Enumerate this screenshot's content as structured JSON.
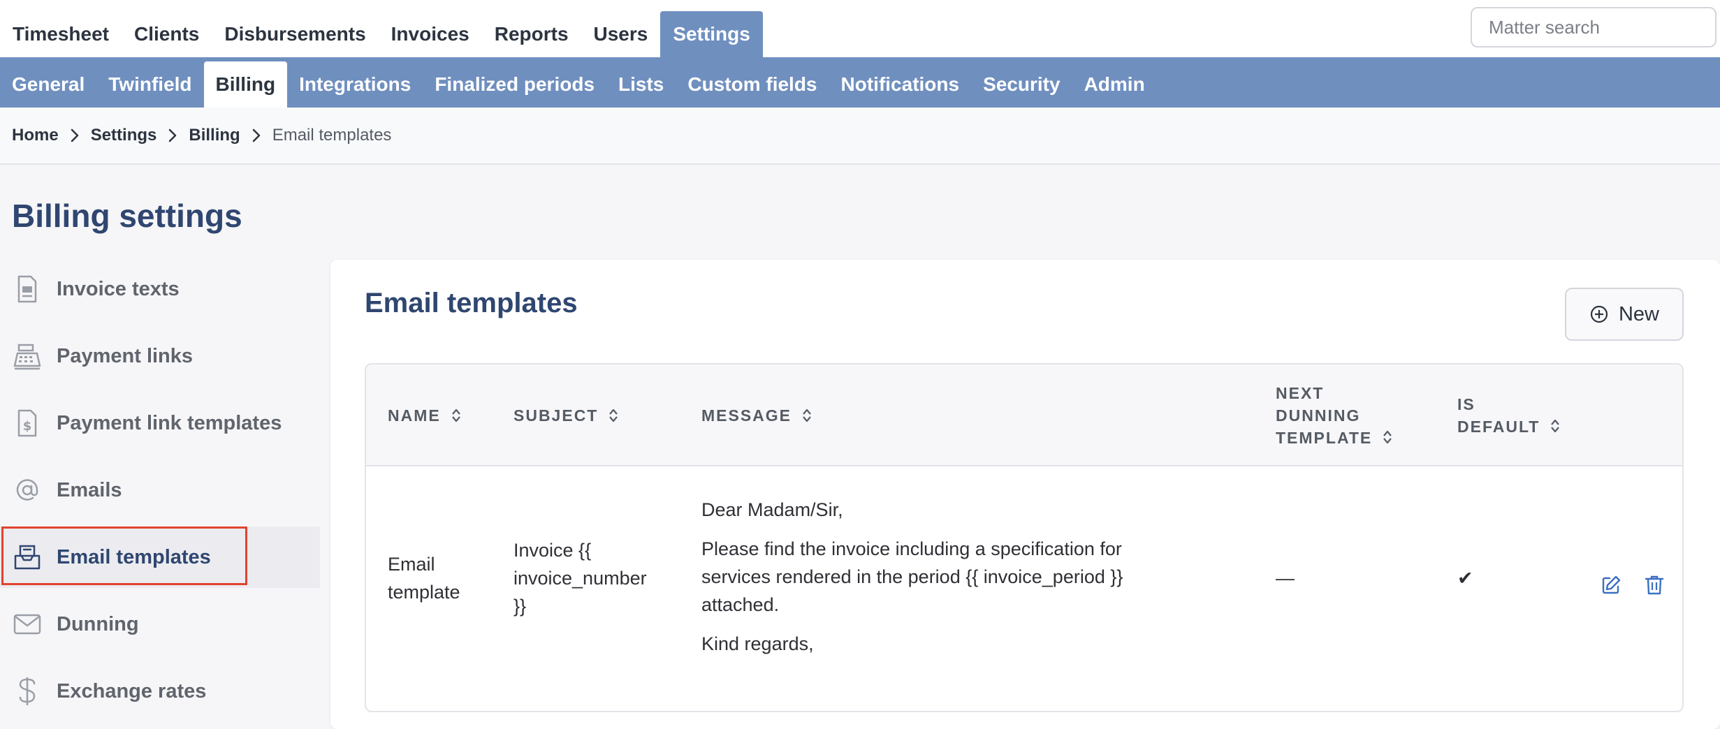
{
  "top_nav": {
    "tabs": [
      "Timesheet",
      "Clients",
      "Disbursements",
      "Invoices",
      "Reports",
      "Users",
      "Settings"
    ],
    "active": "Settings"
  },
  "search": {
    "placeholder": "Matter search",
    "value": ""
  },
  "sub_nav": {
    "tabs": [
      "General",
      "Twinfield",
      "Billing",
      "Integrations",
      "Finalized periods",
      "Lists",
      "Custom fields",
      "Notifications",
      "Security",
      "Admin"
    ],
    "active": "Billing"
  },
  "breadcrumb": [
    "Home",
    "Settings",
    "Billing",
    "Email templates"
  ],
  "page_title": "Billing settings",
  "sidebar": {
    "items": [
      {
        "label": "Invoice texts",
        "icon": "document-icon"
      },
      {
        "label": "Payment links",
        "icon": "cash-register-icon"
      },
      {
        "label": "Payment link templates",
        "icon": "dollar-document-icon"
      },
      {
        "label": "Emails",
        "icon": "at-sign-icon"
      },
      {
        "label": "Email templates",
        "icon": "inbox-tray-icon"
      },
      {
        "label": "Dunning",
        "icon": "envelope-icon"
      },
      {
        "label": "Exchange rates",
        "icon": "dollar-icon"
      }
    ],
    "active": "Email templates"
  },
  "main": {
    "title": "Email templates",
    "new_button": "New",
    "table": {
      "headers": {
        "name": "NAME",
        "subject": "SUBJECT",
        "message": "MESSAGE",
        "next_dunning": [
          "NEXT",
          "DUNNING",
          "TEMPLATE"
        ],
        "is_default": [
          "IS",
          "DEFAULT"
        ]
      },
      "rows": [
        {
          "name": [
            "Email",
            "template"
          ],
          "subject": [
            "Invoice {{",
            "invoice_number",
            "}}"
          ],
          "message": {
            "greeting": "Dear Madam/Sir,",
            "body": [
              "Please find the invoice including a specification for",
              "services rendered in the period {{ invoice_period }}",
              "attached."
            ],
            "closing": "Kind regards,"
          },
          "next_dunning_template": "—",
          "is_default": "✔"
        }
      ]
    }
  },
  "colors": {
    "nav_blue": "#6f8fbf",
    "heading_navy": "#2f4670",
    "highlight_red": "#e0442e",
    "action_blue": "#3b6fc2"
  }
}
